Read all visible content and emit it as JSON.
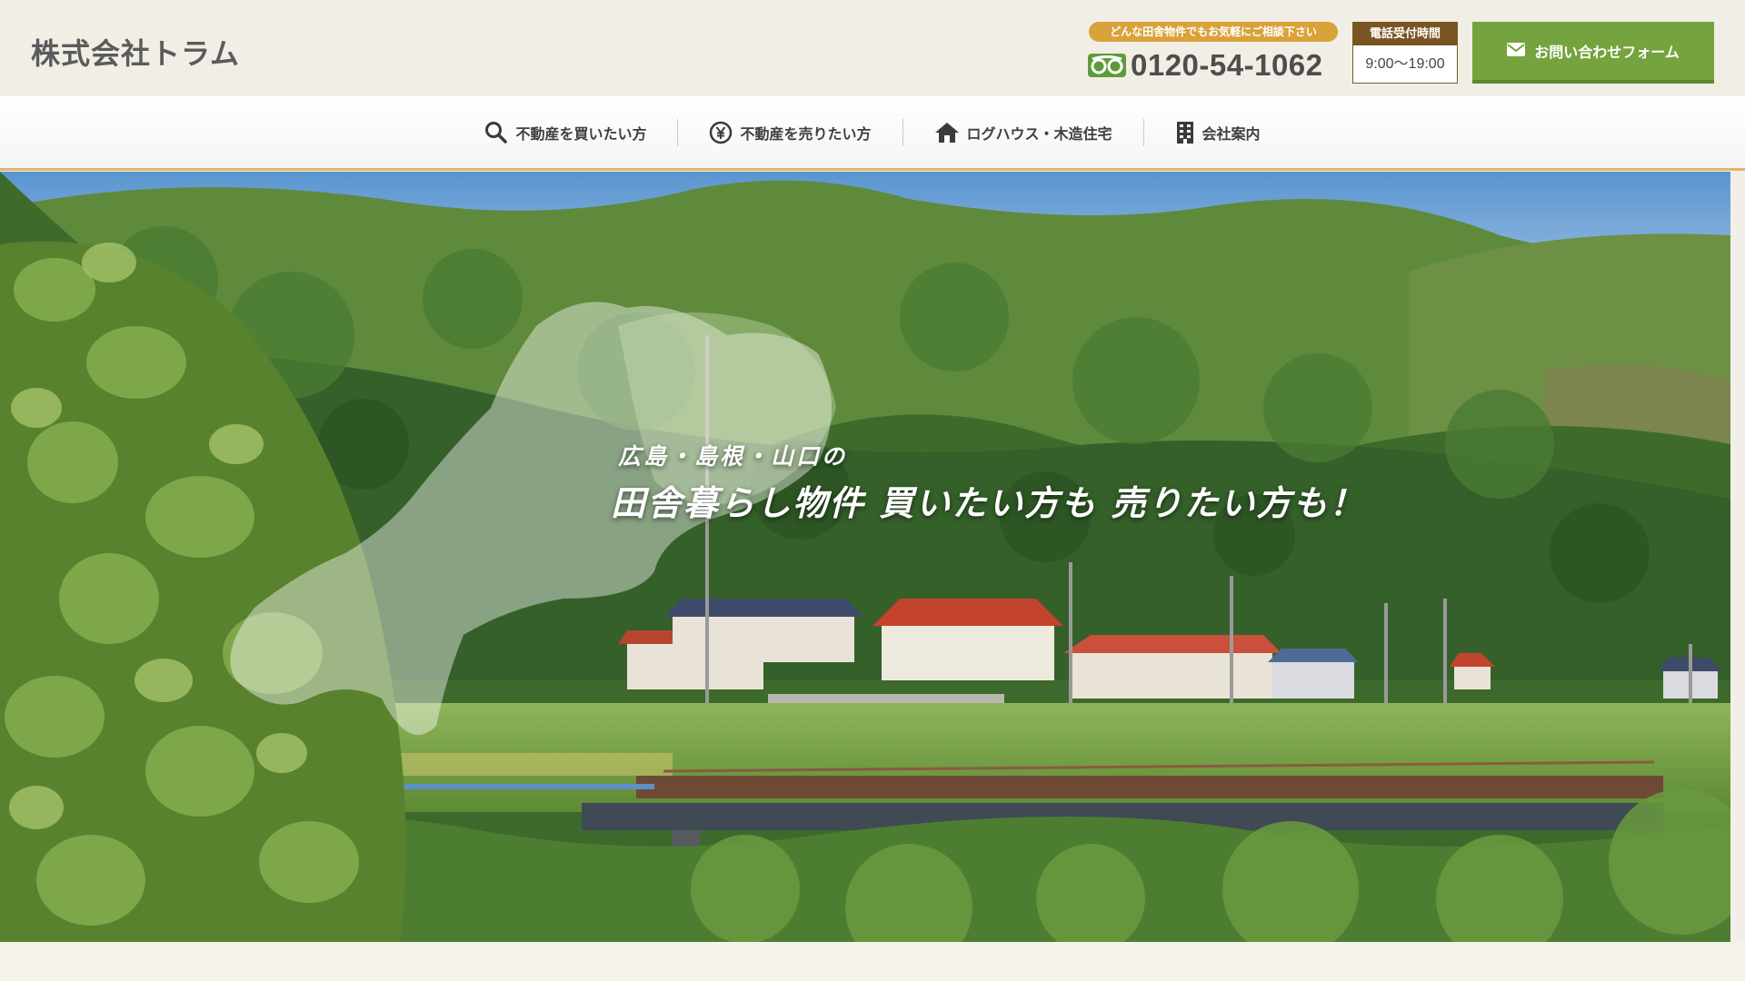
{
  "header": {
    "company_name": "株式会社トラム",
    "phone_note": "どんな田舎物件でもお気軽にご相談下さい",
    "phone_number": "0120-54-1062",
    "hours_title": "電話受付時間",
    "hours_value": "9:00〜19:00",
    "contact_label": "お問い合わせフォーム"
  },
  "nav": {
    "items": [
      {
        "label": "不動産を買いたい方",
        "icon": "search-icon"
      },
      {
        "label": "不動産を売りたい方",
        "icon": "yen-icon"
      },
      {
        "label": "ログハウス・木造住宅",
        "icon": "house-icon"
      },
      {
        "label": "会社案内",
        "icon": "building-icon"
      }
    ]
  },
  "hero": {
    "sub_heading": "広島・島根・山口の",
    "main_heading": "田舎暮らし物件 買いたい方も 売りたい方も！"
  },
  "colors": {
    "accent_green": "#75a33d",
    "accent_orange": "#d9a23a",
    "accent_brown": "#7a5422"
  }
}
